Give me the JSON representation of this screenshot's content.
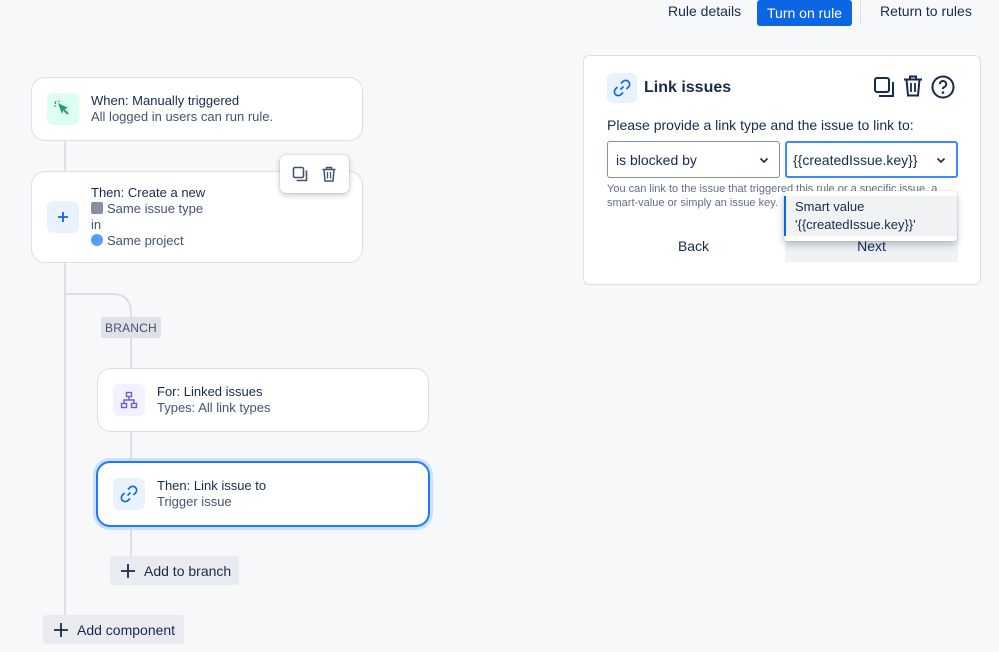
{
  "header": {
    "rule_details": "Rule details",
    "turn_on_rule": "Turn on rule",
    "return_to_rules": "Return to rules"
  },
  "flow": {
    "trigger": {
      "title": "When: Manually triggered",
      "subtitle": "All logged in users can run rule.",
      "icon": "cursor-click-icon",
      "color": "#22a06b"
    },
    "create": {
      "title": "Then: Create a new",
      "issue_type": "Same issue type",
      "in_label": "in",
      "project": "Same project",
      "icon": "plus-icon"
    },
    "branch_label": "BRANCH",
    "for_linked": {
      "title": "For: Linked issues",
      "subtitle": "Types: All link types",
      "icon": "hierarchy-icon"
    },
    "link_issue": {
      "title": "Then: Link issue to",
      "subtitle": "Trigger issue",
      "icon": "link-icon"
    },
    "add_to_branch": "Add to branch",
    "add_component": "Add component"
  },
  "panel": {
    "title": "Link issues",
    "prompt": "Please provide a link type and the issue to link to:",
    "link_type_value": "is blocked by",
    "issue_value": "{{createdIssue.key}}",
    "help_text": "You can link to the issue that triggered this rule or a specific issue, a smart-value or simply an issue key.",
    "back_label": "Back",
    "next_label": "Next",
    "dropdown_option_line1": "Smart value",
    "dropdown_option_line2": "'{{createdIssue.key}}'"
  },
  "colors": {
    "primary": "#0c66e4",
    "selected_border": "#1d7afc",
    "connector": "#dcdfe4"
  }
}
